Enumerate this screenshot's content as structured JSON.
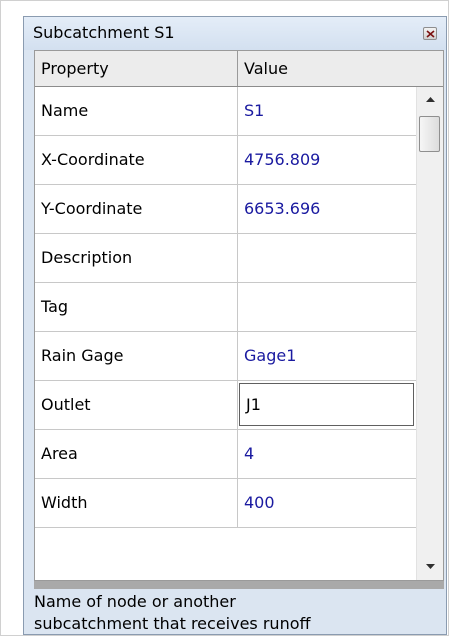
{
  "window": {
    "title": "Subcatchment S1"
  },
  "grid": {
    "header": {
      "property": "Property",
      "value": "Value"
    },
    "rows": [
      {
        "property": "Name",
        "value": "S1"
      },
      {
        "property": "X-Coordinate",
        "value": "4756.809"
      },
      {
        "property": "Y-Coordinate",
        "value": "6653.696"
      },
      {
        "property": "Description",
        "value": ""
      },
      {
        "property": "Tag",
        "value": ""
      },
      {
        "property": "Rain Gage",
        "value": "Gage1"
      },
      {
        "property": "Outlet",
        "value": "J1"
      },
      {
        "property": "Area",
        "value": "4"
      },
      {
        "property": "Width",
        "value": "400"
      }
    ]
  },
  "description": {
    "line1": "Name of node or another",
    "line2": "subcatchment that receives runoff"
  },
  "colors": {
    "value_text": "#1a1aa0",
    "panel_background": "#dbe5f1"
  },
  "icons": {
    "close": "close-icon",
    "scroll_up": "arrow-up-icon",
    "scroll_down": "arrow-down-icon"
  }
}
